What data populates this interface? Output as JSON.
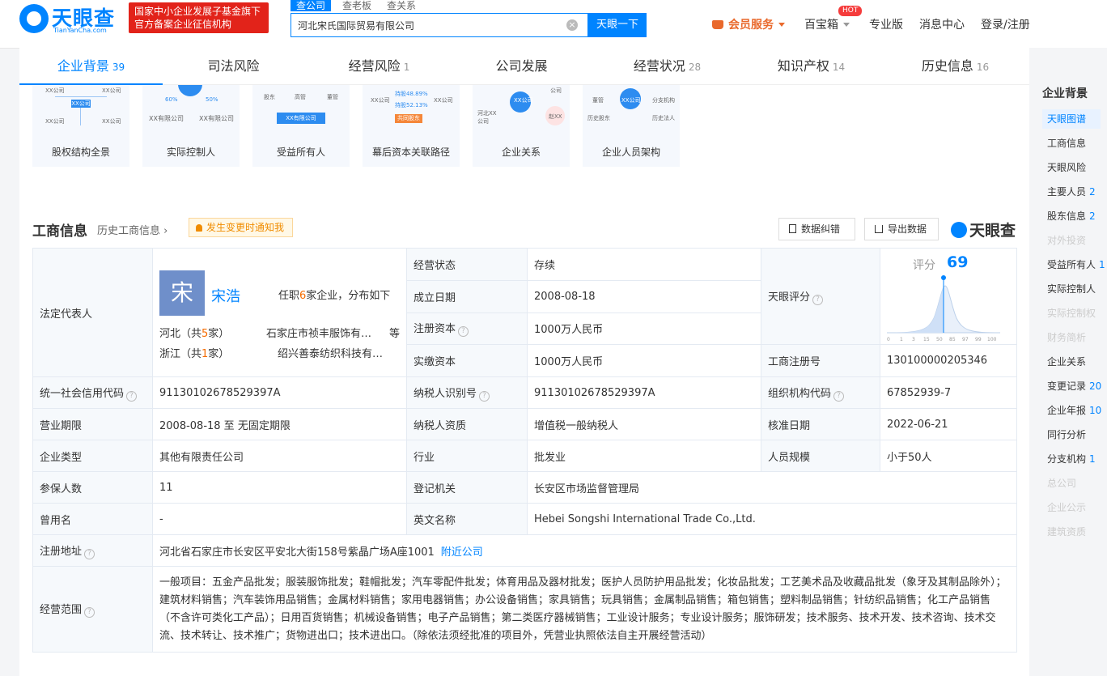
{
  "header": {
    "logo_cn": "天眼查",
    "logo_en": "TianYanCha.com",
    "slogan_line1": "国家中小企业发展子基金旗下",
    "slogan_line2": "官方备案企业征信机构",
    "search_tabs": [
      "查公司",
      "查老板",
      "查关系"
    ],
    "search_value": "河北宋氏国际贸易有限公司",
    "search_button": "天眼一下",
    "vip": "会员服务",
    "baobaoxiang": "百宝箱",
    "hot_badge": "HOT",
    "pro": "专业版",
    "messages": "消息中心",
    "login": "登录/注册"
  },
  "tabs": [
    {
      "label": "企业背景",
      "count": "39"
    },
    {
      "label": "司法风险",
      "count": ""
    },
    {
      "label": "经营风险",
      "count": "1"
    },
    {
      "label": "公司发展",
      "count": ""
    },
    {
      "label": "经营状况",
      "count": "28"
    },
    {
      "label": "知识产权",
      "count": "14"
    },
    {
      "label": "历史信息",
      "count": "16"
    }
  ],
  "maps": [
    {
      "label": "股权结构全景",
      "nodes": [
        "XX公司",
        "XX公司",
        "XX公司",
        "XX公司",
        "XX公司"
      ]
    },
    {
      "label": "实际控制人",
      "nodes": [
        "60%",
        "50%",
        "XX有限公司",
        "XX有限公司"
      ]
    },
    {
      "label": "受益所有人",
      "nodes": [
        "股东",
        "高管",
        "董管",
        "XX有限公司"
      ]
    },
    {
      "label": "幕后资本关联路径",
      "nodes": [
        "XX公司",
        "XX公司",
        "持股48.89%",
        "持股52.13%",
        "共同股东"
      ]
    },
    {
      "label": "企业关系",
      "nodes": [
        "XX公司",
        "公司",
        "河北XX公司",
        "赵XX"
      ]
    },
    {
      "label": "企业人员架构",
      "nodes": [
        "董管",
        "XX公司",
        "分支机构",
        "历史股东",
        "历史法人"
      ]
    }
  ],
  "section": {
    "title": "工商信息",
    "history": "历史工商信息",
    "notify": "发生变更时通知我",
    "correct_btn": "数据纠错",
    "export_btn": "导出数据",
    "brand": "天眼查"
  },
  "rep": {
    "label": "法定代表人",
    "avatar": "宋",
    "name": "宋浩",
    "tenure_pre": "任职",
    "tenure_count": "6",
    "tenure_post": "家企业，分布如下",
    "regions": [
      {
        "prov": "河北（共",
        "count": "5",
        "unit": "家）",
        "company": "石家庄市祯丰服饰有…"
      },
      {
        "prov": "浙江（共",
        "count": "1",
        "unit": "家）",
        "company": "绍兴善泰纺织科技有…"
      }
    ],
    "etc": "等"
  },
  "info": {
    "status_l": "经营状态",
    "status_v": "存续",
    "found_l": "成立日期",
    "found_v": "2008-08-18",
    "regcap_l": "注册资本",
    "regcap_v": "1000万人民币",
    "paidcap_l": "实缴资本",
    "paidcap_v": "1000万人民币",
    "score_l": "天眼评分",
    "score_label": "评分",
    "score": "69",
    "score_ticks": [
      "0",
      "1",
      "3",
      "15",
      "50",
      "85",
      "97",
      "99",
      "100"
    ],
    "regno_l": "工商注册号",
    "regno_v": "130100000205346",
    "credit_l": "统一社会信用代码",
    "credit_v": "91130102678529397A",
    "taxid_l": "纳税人识别号",
    "taxid_v": "91130102678529397A",
    "org_l": "组织机构代码",
    "org_v": "67852939-7",
    "term_l": "营业期限",
    "term_v": "2008-08-18 至 无固定期限",
    "taxq_l": "纳税人资质",
    "taxq_v": "增值税一般纳税人",
    "approve_l": "核准日期",
    "approve_v": "2022-06-21",
    "type_l": "企业类型",
    "type_v": "其他有限责任公司",
    "industry_l": "行业",
    "industry_v": "批发业",
    "staff_l": "人员规模",
    "staff_v": "小于50人",
    "insured_l": "参保人数",
    "insured_v": "11",
    "authority_l": "登记机关",
    "authority_v": "长安区市场监督管理局",
    "former_l": "曾用名",
    "former_v": "-",
    "en_l": "英文名称",
    "en_v": "Hebei Songshi International Trade Co.,Ltd.",
    "addr_l": "注册地址",
    "addr_v": "河北省石家庄市长安区平安北大街158号紫晶广场A座1001",
    "addr_link": "附近公司",
    "scope_l": "经营范围",
    "scope_v": "一般项目：五金产品批发；服装服饰批发；鞋帽批发；汽车零配件批发；体育用品及器材批发；医护人员防护用品批发；化妆品批发；工艺美术品及收藏品批发（象牙及其制品除外）；建筑材料销售；汽车装饰用品销售；金属材料销售；家用电器销售；办公设备销售；家具销售；玩具销售；金属制品销售；箱包销售；塑料制品销售；针纺织品销售；化工产品销售（不含许可类化工产品）；日用百货销售；机械设备销售；电子产品销售；第二类医疗器械销售；工业设计服务；专业设计服务；服饰研发；技术服务、技术开发、技术咨询、技术交流、技术转让、技术推广；货物进出口；技术进出口。（除依法须经批准的项目外，凭营业执照依法自主开展经营活动）"
  },
  "sidebar": {
    "title": "企业背景",
    "items": [
      {
        "label": "天眼图谱",
        "count": "",
        "state": "on"
      },
      {
        "label": "工商信息",
        "count": "",
        "state": ""
      },
      {
        "label": "天眼风险",
        "count": "",
        "state": ""
      },
      {
        "label": "主要人员",
        "count": "2",
        "state": ""
      },
      {
        "label": "股东信息",
        "count": "2",
        "state": ""
      },
      {
        "label": "对外投资",
        "count": "",
        "state": "dis"
      },
      {
        "label": "受益所有人",
        "count": "1",
        "state": ""
      },
      {
        "label": "实际控制人",
        "count": "",
        "state": ""
      },
      {
        "label": "实际控制权",
        "count": "",
        "state": "dis"
      },
      {
        "label": "财务简析",
        "count": "",
        "state": "dis"
      },
      {
        "label": "企业关系",
        "count": "",
        "state": ""
      },
      {
        "label": "变更记录",
        "count": "20",
        "state": ""
      },
      {
        "label": "企业年报",
        "count": "10",
        "state": ""
      },
      {
        "label": "同行分析",
        "count": "",
        "state": ""
      },
      {
        "label": "分支机构",
        "count": "1",
        "state": ""
      },
      {
        "label": "总公司",
        "count": "",
        "state": "dis"
      },
      {
        "label": "企业公示",
        "count": "",
        "state": "dis"
      },
      {
        "label": "建筑资质",
        "count": "",
        "state": "dis"
      }
    ]
  },
  "colors": {
    "brand": "#0084ff",
    "red": "#e2231a",
    "orange": "#f56c00"
  }
}
